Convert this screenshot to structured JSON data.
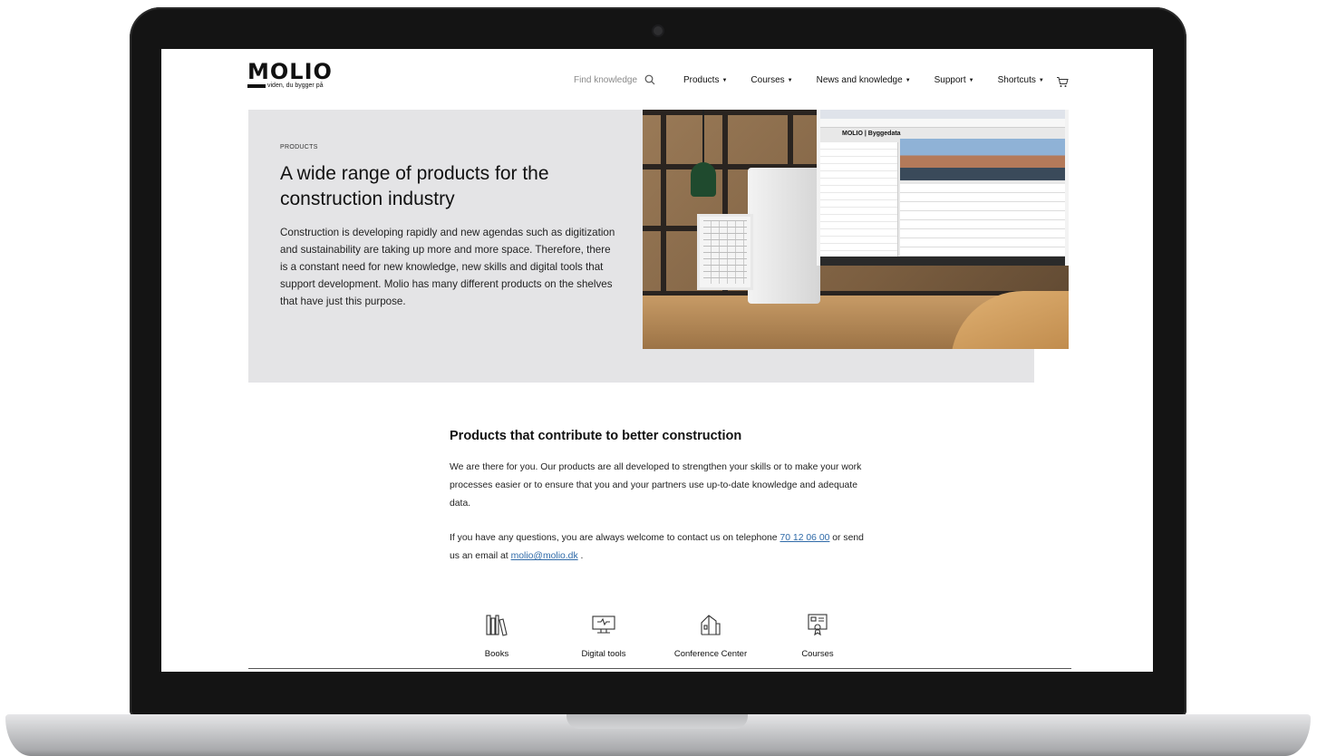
{
  "header": {
    "logo_word": "MOLIO",
    "logo_tagline": "viden, du bygger på",
    "search_placeholder": "Find knowledge",
    "nav": [
      {
        "label": "Products"
      },
      {
        "label": "Courses"
      },
      {
        "label": "News and knowledge"
      },
      {
        "label": "Support"
      },
      {
        "label": "Shortcuts"
      }
    ]
  },
  "hero": {
    "eyebrow": "PRODUCTS",
    "title": "A wide range of products for the construction industry",
    "body": "Construction is developing rapidly and new agendas such as digitization and sustainability are taking up more and more space. Therefore, there is a constant need for new knowledge, new skills and digital tools that support development. Molio has many different products on the shelves that have just this purpose.",
    "image_screen_logo": "MOLIO | Byggedata"
  },
  "content": {
    "title": "Products that contribute to better construction",
    "body": "We are there for you. Our products are all developed to strengthen your skills or to make your work processes easier or to ensure that you and your partners use up-to-date knowledge and adequate data.",
    "contact_prefix": "If you have any questions, you are always welcome to contact us on telephone ",
    "phone": "70 12 06 00",
    "contact_middle": " or send us an email at ",
    "email": "molio@molio.dk",
    "contact_suffix": " ."
  },
  "categories": [
    {
      "label": "Books",
      "icon": "books-icon"
    },
    {
      "label": "Digital tools",
      "icon": "monitor-icon"
    },
    {
      "label": "Conference Center",
      "icon": "building-icon"
    },
    {
      "label": "Courses",
      "icon": "certificate-icon"
    }
  ],
  "colors": {
    "hero_bg": "#e4e4e6",
    "link": "#2f6aa8",
    "text": "#111111"
  }
}
